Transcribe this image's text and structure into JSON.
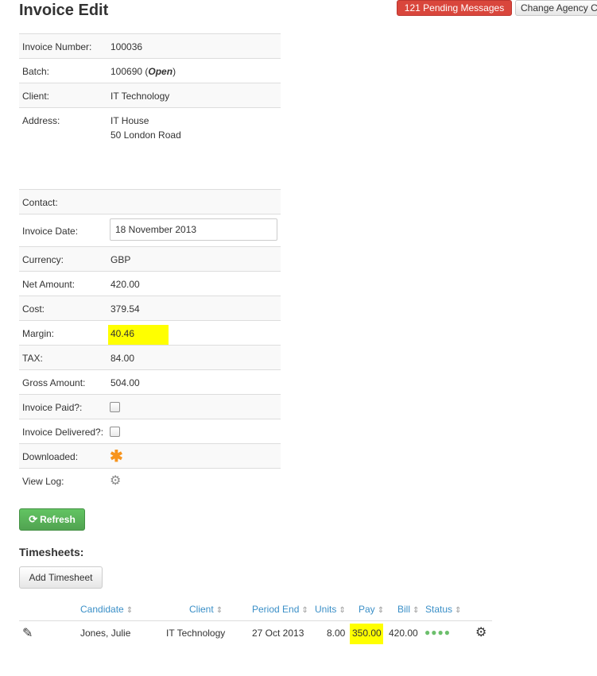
{
  "page": {
    "title": "Invoice Edit"
  },
  "header": {
    "pending_label": "121 Pending Messages",
    "agency_label": "Change Agency C"
  },
  "details": {
    "invoice_number": {
      "label": "Invoice Number:",
      "value": "100036"
    },
    "batch": {
      "label": "Batch:",
      "value": "100690",
      "status": "Open"
    },
    "client": {
      "label": "Client:",
      "value": "IT Technology"
    },
    "address": {
      "label": "Address:",
      "line1": "IT House",
      "line2": "50 London Road"
    },
    "contact": {
      "label": "Contact:",
      "value": ""
    },
    "invoice_date": {
      "label": "Invoice Date:",
      "value": "18 November 2013"
    },
    "currency": {
      "label": "Currency:",
      "value": "GBP"
    },
    "net_amount": {
      "label": "Net Amount:",
      "value": "420.00"
    },
    "cost": {
      "label": "Cost:",
      "value": "379.54"
    },
    "margin": {
      "label": "Margin:",
      "value": "40.46"
    },
    "tax": {
      "label": "TAX:",
      "value": "84.00"
    },
    "gross_amount": {
      "label": "Gross Amount:",
      "value": "504.00"
    },
    "invoice_paid": {
      "label": "Invoice Paid?:",
      "checked": false
    },
    "invoice_delivered": {
      "label": "Invoice Delivered?:",
      "checked": false
    },
    "downloaded": {
      "label": "Downloaded:",
      "icon": "asterisk-icon"
    },
    "view_log": {
      "label": "View Log:",
      "icon": "gear-icon"
    }
  },
  "actions": {
    "refresh_label": "Refresh"
  },
  "timesheets": {
    "title": "Timesheets:",
    "add_label": "Add Timesheet",
    "columns": [
      "Candidate",
      "Client",
      "Period End",
      "Units",
      "Pay",
      "Bill",
      "Status"
    ],
    "rows": [
      {
        "candidate": "Jones, Julie",
        "client": "IT Technology",
        "period_end": "27 Oct 2013",
        "units": "8.00",
        "pay": "350.00",
        "bill": "420.00",
        "status": "●●●●"
      }
    ]
  },
  "colors": {
    "pending": "#d9463c",
    "refresh": "#51a351",
    "link": "#3a8fc7",
    "highlight": "#ffff00"
  }
}
